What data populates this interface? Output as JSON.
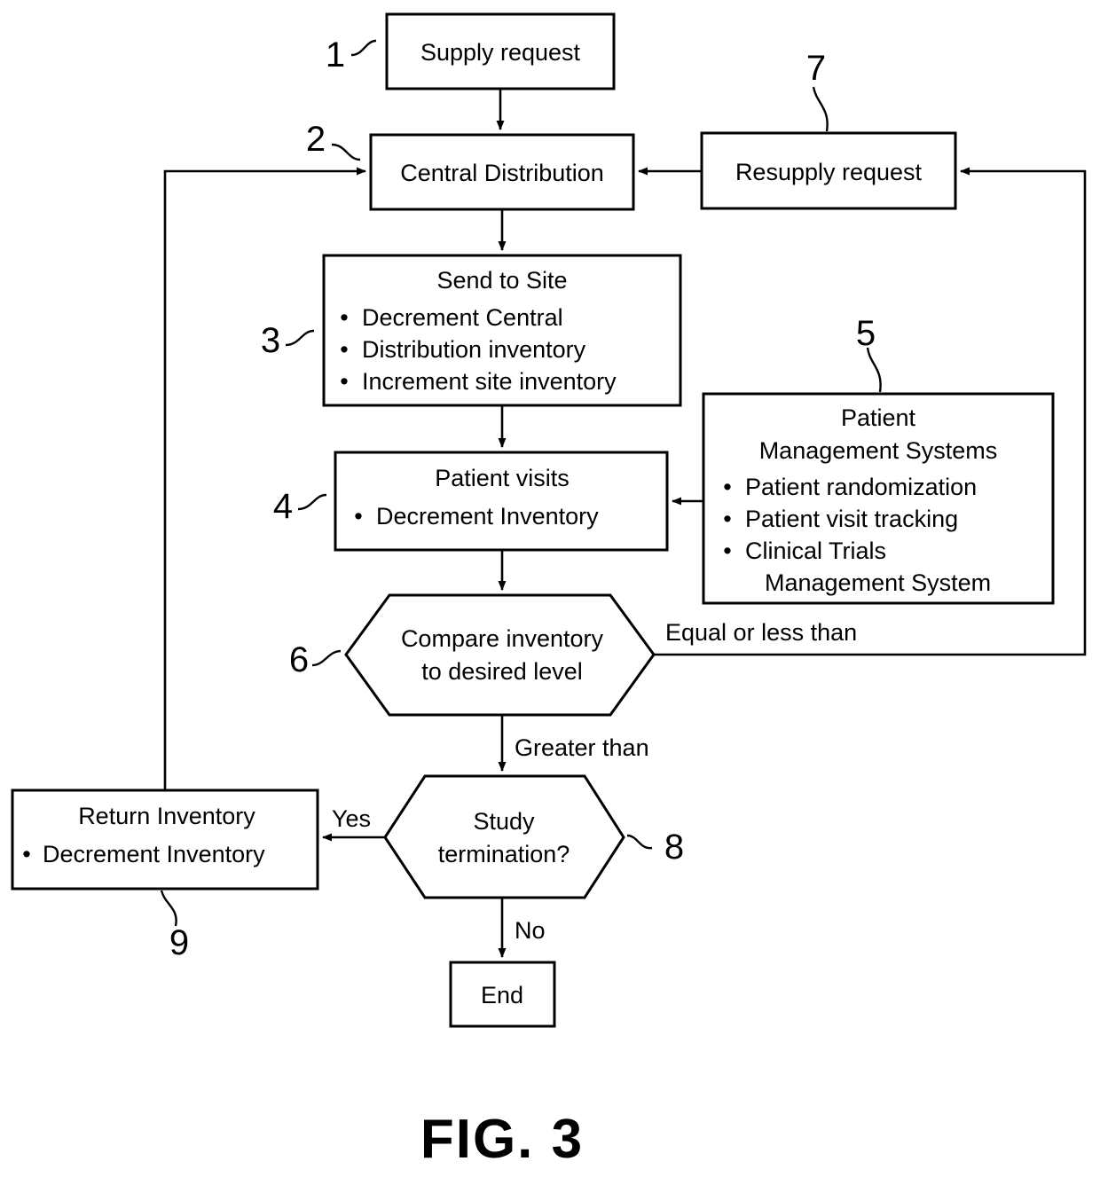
{
  "figure": {
    "caption": "FIG. 3",
    "background_color": "#ffffff",
    "line_color": "#000000"
  },
  "nodes": {
    "supply_request": {
      "ref": "1",
      "shape": "rectangle",
      "title": "Supply request"
    },
    "central_distribution": {
      "ref": "2",
      "shape": "rectangle",
      "title": "Central Distribution"
    },
    "send_to_site": {
      "ref": "3",
      "shape": "rectangle",
      "title": "Send to Site",
      "bullets": [
        "Decrement Central",
        "Distribution inventory",
        "Increment site inventory"
      ],
      "bullet_marker": "•"
    },
    "patient_visits": {
      "ref": "4",
      "shape": "rectangle",
      "title": "Patient visits",
      "bullets": [
        "Decrement Inventory"
      ],
      "bullet_marker": "•"
    },
    "patient_management_systems": {
      "ref": "5",
      "shape": "rectangle",
      "title_line_1": "Patient",
      "title_line_2": "Management Systems",
      "bullets": [
        "Patient randomization",
        "Patient visit tracking",
        "Clinical Trials"
      ],
      "bullet_continuation": "Management System",
      "bullet_marker": "•"
    },
    "compare_inventory": {
      "ref": "6",
      "shape": "hexagon",
      "title_line_1": "Compare inventory",
      "title_line_2": "to desired level"
    },
    "resupply_request": {
      "ref": "7",
      "shape": "rectangle",
      "title": "Resupply request"
    },
    "study_termination": {
      "ref": "8",
      "shape": "hexagon",
      "title_line_1": "Study",
      "title_line_2": "termination?"
    },
    "return_inventory": {
      "ref": "9",
      "shape": "rectangle",
      "title": "Return Inventory",
      "bullets": [
        "Decrement Inventory"
      ],
      "bullet_marker": "•"
    },
    "end": {
      "shape": "rectangle",
      "title": "End"
    }
  },
  "edge_labels": {
    "equal_or_less_than": "Equal or less than",
    "greater_than": "Greater than",
    "yes": "Yes",
    "no": "No"
  }
}
